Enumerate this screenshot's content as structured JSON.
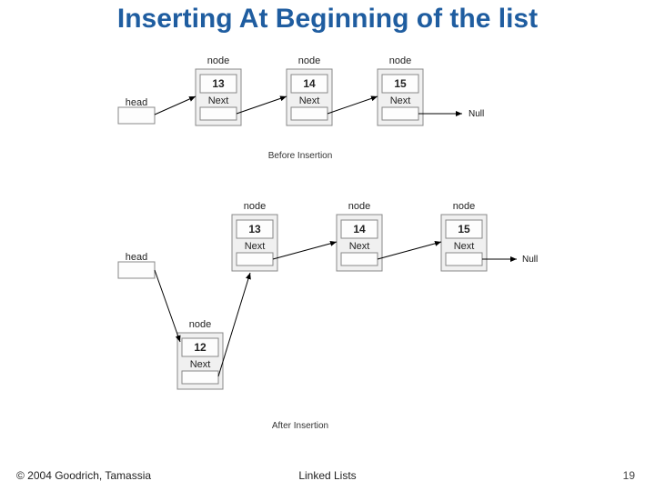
{
  "title": "Inserting At Beginning of the list",
  "footer": {
    "left": "© 2004 Goodrich, Tamassia",
    "center": "Linked Lists",
    "right": "19"
  },
  "labels": {
    "node": "node",
    "head": "head",
    "next": "Next",
    "null": "Null",
    "before": "Before Insertion",
    "after": "After Insertion"
  },
  "before": {
    "values": [
      "13",
      "14",
      "15"
    ]
  },
  "after": {
    "new": "12",
    "values": [
      "13",
      "14",
      "15"
    ]
  }
}
